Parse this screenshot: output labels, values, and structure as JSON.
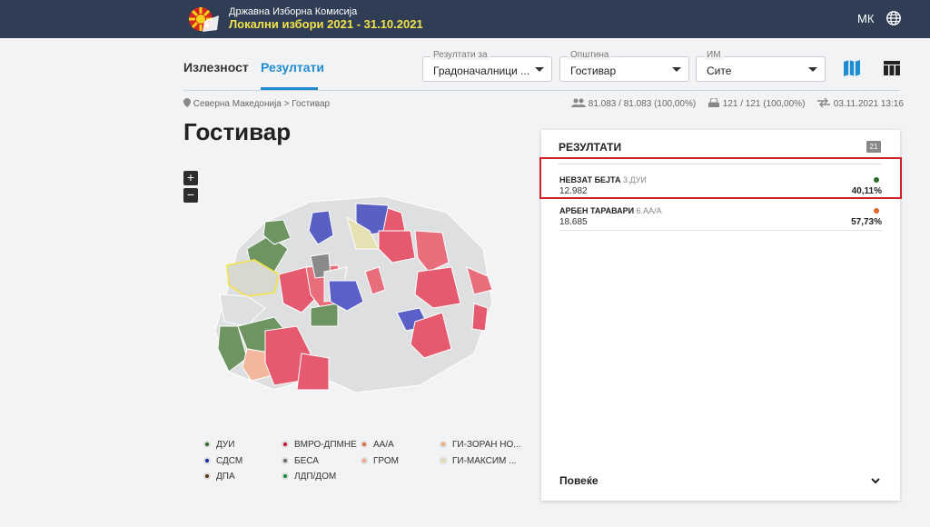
{
  "header": {
    "org": "Државна Изборна Комисија",
    "election": "Локални избори 2021 - 31.10.2021",
    "lang": "МК",
    "logo_icon": "sun-flag-logo",
    "globe_icon": "globe-icon"
  },
  "tabs": [
    {
      "label": "Излезност",
      "active": false
    },
    {
      "label": "Резултати",
      "active": true
    }
  ],
  "filters": [
    {
      "label": "Резултати за",
      "value": "Градоначалници ..."
    },
    {
      "label": "Општина",
      "value": "Гостивар"
    },
    {
      "label": "ИМ",
      "value": "Сите"
    }
  ],
  "view_icons": [
    "map-icon",
    "table-icon"
  ],
  "breadcrumb": {
    "root": "Северна Македонија",
    "sep": ">",
    "current": "Гостивар"
  },
  "stats": {
    "voters": "81.083 / 81.083 (100,00%)",
    "stations": "121 / 121 (100,00%)",
    "updated": "03.11.2021 13:16"
  },
  "page_title": "Гостивар",
  "zoom": {
    "in": "+",
    "out": "−"
  },
  "legend": [
    {
      "name": "ДУИ",
      "color": "#2e6b2a"
    },
    {
      "name": "ВМРО-ДПМНЕ",
      "color": "#c8102e"
    },
    {
      "name": "АА/А",
      "color": "#e06a2b"
    },
    {
      "name": "ГИ-ЗОРАН НО...",
      "color": "#f2a477"
    },
    {
      "name": "СДСМ",
      "color": "#1b2aa8"
    },
    {
      "name": "БЕСА",
      "color": "#6b6b6b"
    },
    {
      "name": "ГРОМ",
      "color": "#f3a27c"
    },
    {
      "name": "ГИ-МАКСИМ ...",
      "color": "#e8e0a8"
    },
    {
      "name": "ДПА",
      "color": "#5a3a1e"
    },
    {
      "name": "ЛДП/ДОМ",
      "color": "#1c8a3c"
    }
  ],
  "results": {
    "title": "РЕЗУЛТАТИ",
    "count": "21",
    "candidates": [
      {
        "name": "НЕВЗАТ БЕЈТА",
        "party": "3.ДУИ",
        "votes": "12.982",
        "pct": "40,11%",
        "color": "#2e6b2a",
        "highlighted": true
      },
      {
        "name": "АРБЕН ТАРАВАРИ",
        "party": "6.АА/А",
        "votes": "18.685",
        "pct": "57,73%",
        "color": "#e06a2b",
        "highlighted": false
      }
    ],
    "more": "Повеќе"
  }
}
